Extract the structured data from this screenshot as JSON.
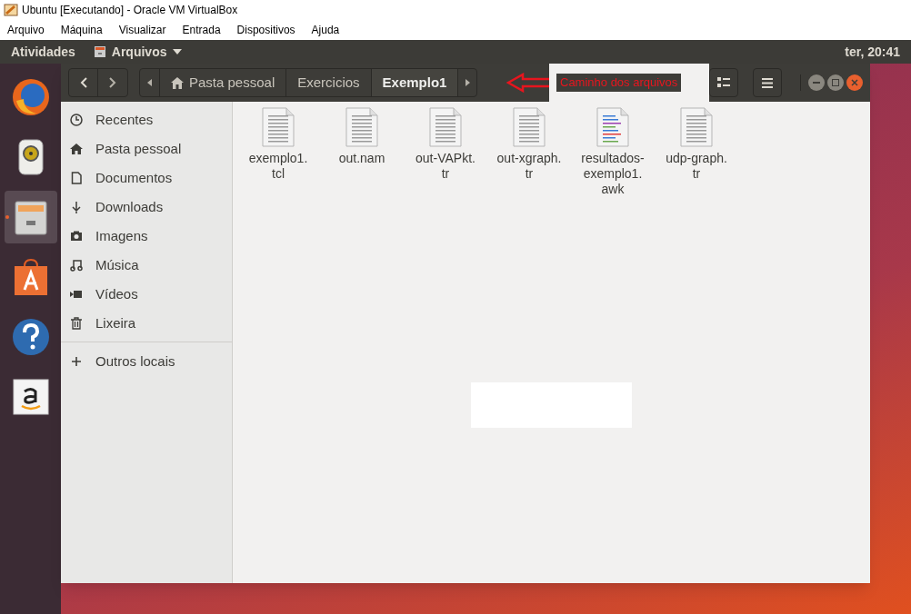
{
  "host_window": {
    "title": "Ubuntu [Executando] - Oracle VM VirtualBox"
  },
  "host_menu": [
    "Arquivo",
    "Máquina",
    "Visualizar",
    "Entrada",
    "Dispositivos",
    "Ajuda"
  ],
  "top_panel": {
    "activities": "Atividades",
    "app_menu": "Arquivos",
    "clock": "ter, 20:41"
  },
  "launcher": [
    {
      "kind": "browser",
      "selected": false
    },
    {
      "kind": "speaker",
      "selected": false
    },
    {
      "kind": "files",
      "selected": true
    },
    {
      "kind": "store",
      "selected": false
    },
    {
      "kind": "help",
      "selected": false
    },
    {
      "kind": "amazon",
      "selected": false
    }
  ],
  "path_bar": [
    {
      "label": "Pasta pessoal",
      "kind": "home",
      "selected": false
    },
    {
      "label": "Exercicios",
      "kind": "folder",
      "selected": false
    },
    {
      "label": "Exemplo1",
      "kind": "folder",
      "selected": true
    }
  ],
  "annotation": "Caminho dos arquivos",
  "sidebar": {
    "items": [
      {
        "label": "Recentes",
        "kind": "recent"
      },
      {
        "label": "Pasta pessoal",
        "kind": "home"
      },
      {
        "label": "Documentos",
        "kind": "document"
      },
      {
        "label": "Downloads",
        "kind": "download"
      },
      {
        "label": "Imagens",
        "kind": "camera"
      },
      {
        "label": "Música",
        "kind": "music"
      },
      {
        "label": "Vídeos",
        "kind": "video"
      },
      {
        "label": "Lixeira",
        "kind": "trash"
      }
    ],
    "other": {
      "label": "Outros locais"
    }
  },
  "files": [
    {
      "name": "exemplo1.\ntcl",
      "kind": "text"
    },
    {
      "name": "out.nam",
      "kind": "text"
    },
    {
      "name": "out-VAPkt.\ntr",
      "kind": "text"
    },
    {
      "name": "out-xgraph.\ntr",
      "kind": "text"
    },
    {
      "name": "resultados-\nexemplo1.\nawk",
      "kind": "script"
    },
    {
      "name": "udp-graph.\ntr",
      "kind": "text"
    }
  ]
}
